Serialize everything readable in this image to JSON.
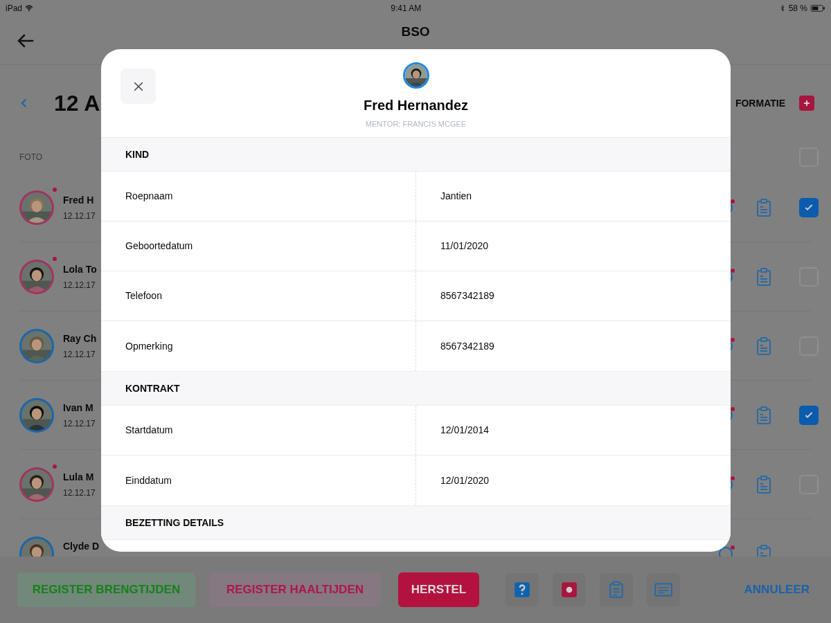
{
  "status_bar": {
    "device": "iPad",
    "time": "9:41 AM",
    "battery": "58 %"
  },
  "header": {
    "title": "BSO"
  },
  "toolbar": {
    "date": "12 A",
    "info_link": "FORMATIE"
  },
  "list": {
    "column_label": "FOTO",
    "select_all_checked": false,
    "rows": [
      {
        "name": "Fred H",
        "date": "12.12.17",
        "color": "#a3335f",
        "alert": true,
        "checked": true
      },
      {
        "name": "Lola To",
        "date": "12.12.17",
        "color": "#a3335f",
        "alert": true,
        "checked": false
      },
      {
        "name": "Ray Ch",
        "date": "12.12.17",
        "color": "#1a66a8",
        "alert": false,
        "checked": false
      },
      {
        "name": "Ivan M",
        "date": "12.12.17",
        "color": "#1a66a8",
        "alert": false,
        "checked": true
      },
      {
        "name": "Lula M",
        "date": "12.12.17",
        "color": "#a3335f",
        "alert": true,
        "checked": false
      },
      {
        "name": "Clyde D",
        "color": "#1a66a8",
        "alert": false
      }
    ]
  },
  "modal": {
    "name": "Fred Hernandez",
    "mentor": "MENTOR: FRANCIS MCGEE",
    "sections": [
      {
        "title": "KIND",
        "rows": [
          {
            "label": "Roepnaam",
            "value": "Jantien"
          },
          {
            "label": "Geboortedatum",
            "value": "11/01/2020"
          },
          {
            "label": "Telefoon",
            "value": "8567342189"
          },
          {
            "label": "Opmerking",
            "value": "8567342189"
          }
        ]
      },
      {
        "title": "KONTRAKT",
        "rows": [
          {
            "label": "Startdatum",
            "value": "12/01/2014"
          },
          {
            "label": "Einddatum",
            "value": "12/01/2020"
          }
        ]
      },
      {
        "title": "BEZETTING DETAILS"
      }
    ]
  },
  "bottom_bar": {
    "buttons": [
      {
        "label": "REGISTER BRENGTIJDEN",
        "kind": "arrival"
      },
      {
        "label": "REGISTER HAALTIJDEN",
        "kind": "pickup"
      },
      {
        "label": "HERSTEL",
        "kind": "primary"
      }
    ],
    "cancel": "ANNULEER"
  }
}
